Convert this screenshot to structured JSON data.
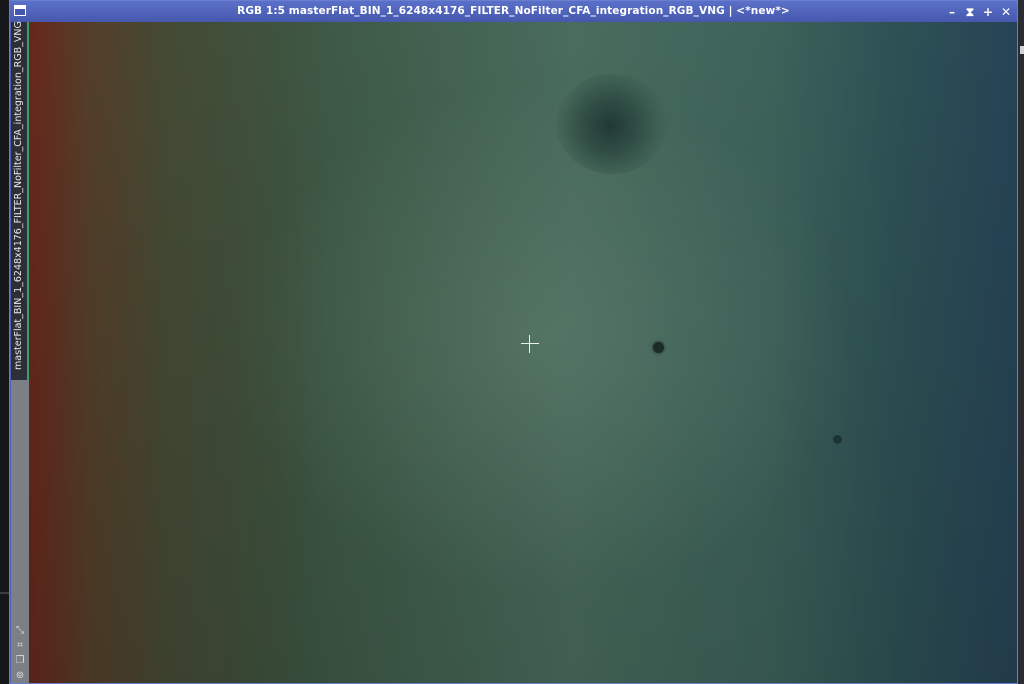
{
  "window": {
    "title": "RGB 1:5 masterFlat_BIN_1_6248x4176_FILTER_NoFilter_CFA_integration_RGB_VNG | <*new*>",
    "controls": {
      "minimize": "–",
      "shade": "⧗",
      "maximize": "+",
      "close": "✕"
    },
    "side_tab_label": "masterFlat_BIN_1_6248x4176_FILTER_NoFilter_CFA_integration_RGB_VNG",
    "zoom_ratio": "1:5",
    "color_space": "RGB",
    "accent_color": "#4b5fb3",
    "active_tab_color": "#39a06a"
  },
  "icons": {
    "window_menu": "window-menu-icon",
    "resize": "resize-icon",
    "fit": "fit-view-icon",
    "clone": "clone-view-icon",
    "lock": "lock-icon",
    "cursor": "crosshair-cursor-icon"
  }
}
